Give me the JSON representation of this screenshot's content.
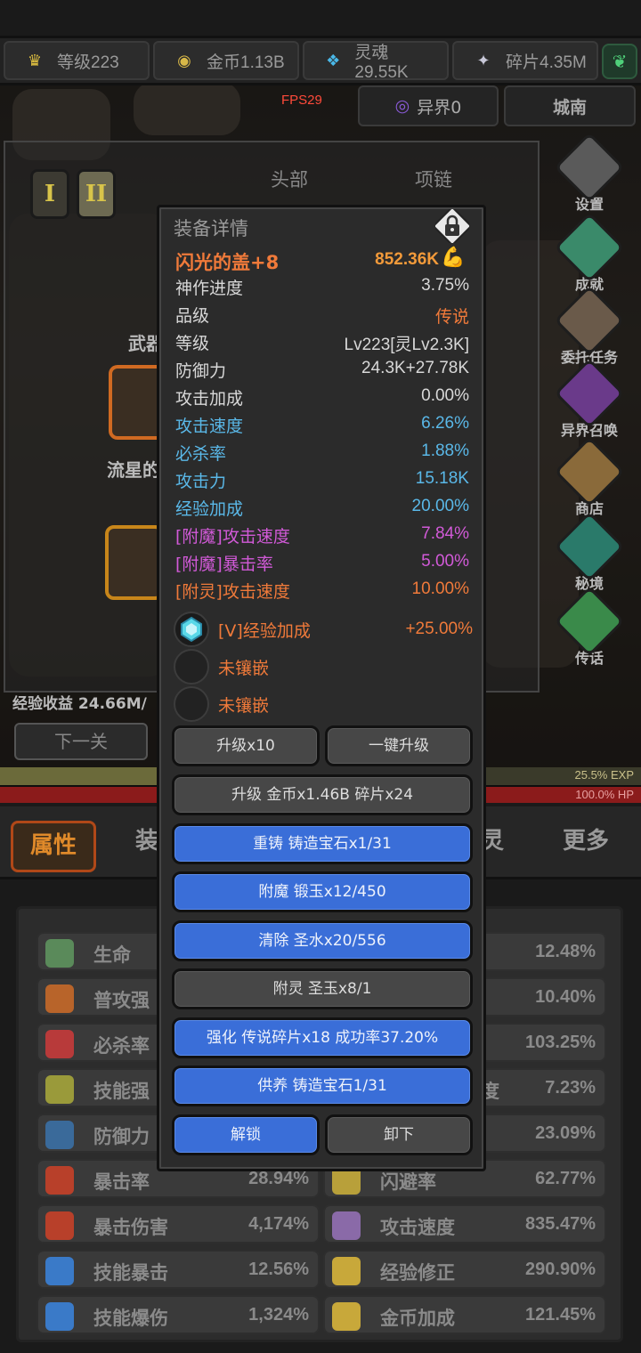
{
  "resources": [
    {
      "label": "等级223",
      "icon": "crown-icon",
      "color": "#e0c040"
    },
    {
      "label": "金币1.13B",
      "icon": "coin-icon",
      "color": "#d8b848"
    },
    {
      "label": "灵魂29.55K",
      "icon": "soul-icon",
      "color": "#4ab8e8"
    },
    {
      "label": "碎片4.35M",
      "icon": "shard-icon",
      "color": "#c8c8d8"
    }
  ],
  "subbar": {
    "world": "异界0",
    "city": "城南",
    "fps": "FPS29"
  },
  "equip_panel": {
    "tiers": [
      "I",
      "II"
    ],
    "slots": [
      "头部",
      "项链"
    ],
    "weapon_label": "武器",
    "weapon_name": "流星的"
  },
  "exp_income": "经验收益 24.66M/",
  "next_level": "下一关",
  "exp_bar": {
    "text": "25.5% EXP",
    "fraction": 0.255
  },
  "hp_bar": {
    "text": "100.0% HP",
    "fraction": 1.0
  },
  "side_menu": [
    "设置",
    "成就",
    "委托任务",
    "异界召唤",
    "商店",
    "秘境",
    "传话"
  ],
  "tabs": {
    "active": "属性",
    "second": "装",
    "fourth": "灵",
    "more": "更多"
  },
  "attributes": [
    {
      "name": "生命",
      "value": "",
      "icon": "life-icon",
      "color": "#5a8a5a"
    },
    {
      "name": "",
      "value": "12.48%",
      "icon": "",
      "color": ""
    },
    {
      "name": "普攻强",
      "value": "",
      "icon": "feather-icon",
      "color": "#b8642a"
    },
    {
      "name": "",
      "value": "10.40%",
      "icon": "",
      "color": ""
    },
    {
      "name": "必杀率",
      "value": "",
      "icon": "crit-icon",
      "color": "#b83a3a"
    },
    {
      "name": "",
      "value": "103.25%",
      "icon": "",
      "color": ""
    },
    {
      "name": "技能强",
      "value": "",
      "icon": "lightning-icon",
      "color": "#9a9a3a"
    },
    {
      "name": "度",
      "value": "7.23%",
      "icon": "",
      "color": ""
    },
    {
      "name": "防御力",
      "value": "",
      "icon": "shield-icon",
      "color": "#3a6a9a"
    },
    {
      "name": "",
      "value": "23.09%",
      "icon": "",
      "color": ""
    },
    {
      "name": "暴击率",
      "value": "28.94%",
      "icon": "claw-icon",
      "color": "#b8402a"
    },
    {
      "name": "闪避率",
      "value": "62.77%",
      "icon": "dodge-icon",
      "color": "#b8a03a"
    },
    {
      "name": "暴击伤害",
      "value": "4,174%",
      "icon": "claw-icon",
      "color": "#b8402a"
    },
    {
      "name": "攻击速度",
      "value": "835.47%",
      "icon": "swords-icon",
      "color": "#8a6aa8"
    },
    {
      "name": "技能暴击",
      "value": "12.56%",
      "icon": "flame-icon",
      "color": "#3a7ac8"
    },
    {
      "name": "经验修正",
      "value": "290.90%",
      "icon": "crown-icon",
      "color": "#c8a83a"
    },
    {
      "name": "技能爆伤",
      "value": "1,324%",
      "icon": "flame-icon",
      "color": "#3a7ac8"
    },
    {
      "name": "金币加成",
      "value": "121.45%",
      "icon": "coin-icon",
      "color": "#c8a83a"
    }
  ],
  "modal": {
    "title": "装备详情",
    "item_name": "闪光的盖+8",
    "power": "852.36K",
    "stats": [
      {
        "name": "神作进度",
        "value": "3.75%",
        "name_color": "#d8d8d8",
        "value_color": "#d8d8d8"
      },
      {
        "name": "品级",
        "value": "传说",
        "name_color": "#d8d8d8",
        "value_color": "#f07a3a"
      },
      {
        "name": "等级",
        "value": "Lv223[灵Lv2.3K]",
        "name_color": "#d8d8d8",
        "value_color": "#d8d8d8"
      },
      {
        "name": "防御力",
        "value": "24.3K+27.78K",
        "name_color": "#d8d8d8",
        "value_color": "#d8d8d8"
      },
      {
        "name": "攻击加成",
        "value": "0.00%",
        "name_color": "#d8d8d8",
        "value_color": "#d8d8d8"
      },
      {
        "name": "攻击速度",
        "value": "6.26%",
        "name_color": "#5ab8e8",
        "value_color": "#5ab8e8"
      },
      {
        "name": "必杀率",
        "value": "1.88%",
        "name_color": "#5ab8e8",
        "value_color": "#5ab8e8"
      },
      {
        "name": "攻击力",
        "value": "15.18K",
        "name_color": "#5ab8e8",
        "value_color": "#5ab8e8"
      },
      {
        "name": "经验加成",
        "value": "20.00%",
        "name_color": "#5ab8e8",
        "value_color": "#5ab8e8"
      },
      {
        "name": "[附魔]攻击速度",
        "value": "7.84%",
        "name_color": "#d25ad8",
        "value_color": "#d25ad8"
      },
      {
        "name": "[附魔]暴击率",
        "value": "5.00%",
        "name_color": "#d25ad8",
        "value_color": "#d25ad8"
      },
      {
        "name": "[附灵]攻击速度",
        "value": "10.00%",
        "name_color": "#f07a3a",
        "value_color": "#f07a3a"
      }
    ],
    "gems": [
      {
        "name": "[V]经验加成",
        "value": "+25.00%",
        "filled": true
      },
      {
        "name": "未镶嵌",
        "value": "",
        "filled": false
      },
      {
        "name": "未镶嵌",
        "value": "",
        "filled": false
      }
    ],
    "buttons": {
      "upgrade10": "升级x10",
      "upgrade_all": "一键升级",
      "upgrade": "升级 金币x1.46B 碎片x24",
      "recast": "重铸 铸造宝石x1/31",
      "enchant": "附魔 锻玉x12/450",
      "clear": "清除 圣水x20/556",
      "spirit": "附灵 圣玉x8/1",
      "strengthen": "强化 传说碎片x18 成功率37.20%",
      "nurture": "供养 铸造宝石1/31",
      "unlock": "解锁",
      "unequip": "卸下"
    }
  }
}
